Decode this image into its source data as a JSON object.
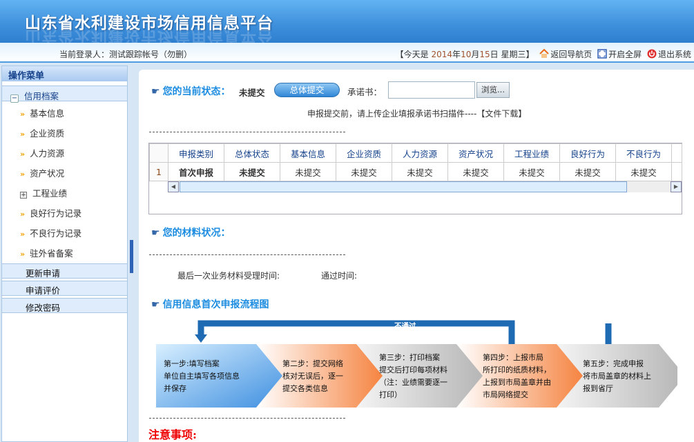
{
  "header": {
    "title": "山东省水利建设市场信用信息平台"
  },
  "topbar": {
    "user_label": "当前登录人：",
    "user_name": "测试跟踪帐号（勿删）",
    "date_prefix": "【今天是 ",
    "year": "2014",
    "y": "年",
    "month": "10",
    "m": "月",
    "day": "15",
    "d": "日 星期三】",
    "home": "返回导航页",
    "fullscreen": "开启全屏",
    "logout": "退出系统"
  },
  "sidebar": {
    "title": "操作菜单",
    "group": "信用档案",
    "items": [
      {
        "label": "基本信息",
        "icon": "arrow"
      },
      {
        "label": "企业资质",
        "icon": "arrow"
      },
      {
        "label": "人力资源",
        "icon": "arrow"
      },
      {
        "label": "资产状况",
        "icon": "arrow"
      },
      {
        "label": "工程业绩",
        "icon": "plus"
      },
      {
        "label": "良好行为记录",
        "icon": "arrow"
      },
      {
        "label": "不良行为记录",
        "icon": "arrow"
      },
      {
        "label": "驻外省备案",
        "icon": "arrow"
      }
    ],
    "links": [
      "更新申请",
      "申请评价",
      "修改密码"
    ]
  },
  "status": {
    "title": "您的当前状态：",
    "value": "未提交",
    "submit": "总体提交",
    "promise_label": "承诺书：",
    "browse": "浏览...",
    "hint": "申报提交前，请上传企业填报承诺书扫描件----【文件下载】"
  },
  "grid": {
    "columns": [
      "申报类别",
      "总体状态",
      "基本信息",
      "企业资质",
      "人力资源",
      "资产状况",
      "工程业绩",
      "良好行为",
      "不良行为"
    ],
    "rows": [
      {
        "num": "1",
        "cells": [
          "首次申报",
          "未提交",
          "未提交",
          "未提交",
          "未提交",
          "未提交",
          "未提交",
          "未提交",
          "未提交"
        ]
      }
    ]
  },
  "materials": {
    "title": "您的材料状况：",
    "last_time": "最后一次业务材料受理时间:",
    "pass_time": "通过时间:"
  },
  "flow": {
    "title": "信用信息首次申报流程图",
    "reject": "不通过",
    "steps": [
      [
        "第一步:填写档案",
        "单位自主填写各项信息",
        "并保存"
      ],
      [
        "第二步：提交网络",
        "核对无误后，逐一",
        "提交各类信息"
      ],
      [
        "第三步：打印档案",
        "提交后打印每项材料",
        "（注：业绩需要逐一",
        "打印）"
      ],
      [
        "第四步：上报市局",
        "所打印的纸质材料，",
        "上报到市局盖章并由",
        "市局网络提交"
      ],
      [
        "第五步：完成申报",
        "将市局盖章的材料上",
        "报到省厅"
      ]
    ]
  },
  "notice": {
    "title": "注意事项:"
  }
}
